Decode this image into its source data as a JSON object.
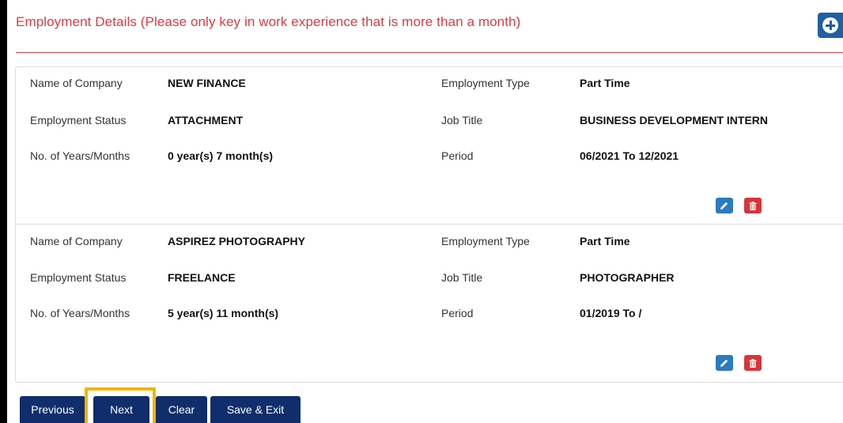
{
  "section": {
    "title": "Employment Details (Please only key in work experience that is more than a month)"
  },
  "labels": {
    "company": "Name of Company",
    "type": "Employment Type",
    "status": "Employment Status",
    "job": "Job Title",
    "years": "No. of Years/Months",
    "period": "Period"
  },
  "records": [
    {
      "company": "NEW FINANCE",
      "type": "Part Time",
      "status": "ATTACHMENT",
      "job": "BUSINESS DEVELOPMENT INTERN",
      "years": "0 year(s) 7 month(s)",
      "period": "06/2021 To 12/2021"
    },
    {
      "company": "ASPIREZ PHOTOGRAPHY",
      "type": "Part Time",
      "status": "FREELANCE",
      "job": "PHOTOGRAPHER",
      "years": "5 year(s) 11 month(s)",
      "period": "01/2019 To /"
    }
  ],
  "buttons": {
    "previous": "Previous",
    "next": "Next",
    "clear": "Clear",
    "save_exit": "Save & Exit"
  },
  "icons": {
    "add": "plus-circle-icon",
    "edit": "pencil-icon",
    "delete": "trash-icon"
  },
  "colors": {
    "title_red": "#e0383e",
    "primary_blue": "#1f5fa3",
    "nav_navy": "#0f2e6b",
    "edit_blue": "#2a7bbf",
    "delete_red": "#d9343a",
    "highlight_yellow": "#f4b400"
  }
}
